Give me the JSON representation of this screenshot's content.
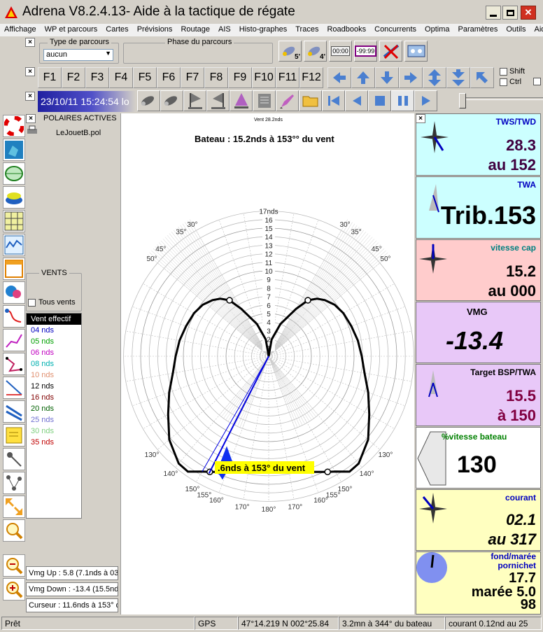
{
  "window": {
    "title": "Adrena V8.2.4.13- Aide à la tactique de régate"
  },
  "menu": [
    "Affichage",
    "WP et parcours",
    "Cartes",
    "Prévisions",
    "Routage",
    "AIS",
    "Histo-graphes",
    "Traces",
    "Roadbooks",
    "Concurrents",
    "Optima",
    "Paramètres",
    "Outils",
    "Aide"
  ],
  "toolbar1": {
    "type_parcours_label": "Type de parcours",
    "type_parcours_value": "aucun",
    "phase_label": "Phase du parcours",
    "btn_5": "5'",
    "btn_4": "4'",
    "btn_timer": "00:00",
    "btn_count": "-99:99"
  },
  "fkeys": [
    "F1",
    "F2",
    "F3",
    "F4",
    "F5",
    "F6",
    "F7",
    "F8",
    "F9",
    "F10",
    "F11",
    "F12"
  ],
  "mods": {
    "shift": "Shift",
    "ctrl": "Ctrl"
  },
  "datetime": "23/10/11 15:24:54 lo",
  "polaires": {
    "title": "POLAIRES ACTIVES",
    "file": "LeJouetB.pol"
  },
  "vents": {
    "title": "VENTS",
    "all_label": "Tous vents",
    "items": [
      {
        "label": "Vent effectif",
        "color": "#ffffff"
      },
      {
        "label": "04 nds",
        "color": "#0000c0"
      },
      {
        "label": "05 nds",
        "color": "#00a000"
      },
      {
        "label": "06 nds",
        "color": "#c000c0"
      },
      {
        "label": "08 nds",
        "color": "#00b0b0"
      },
      {
        "label": "10 nds",
        "color": "#e09070"
      },
      {
        "label": "12 nds",
        "color": "#000000"
      },
      {
        "label": "16 nds",
        "color": "#800000"
      },
      {
        "label": "20 nds",
        "color": "#006000"
      },
      {
        "label": "25 nds",
        "color": "#7070d0"
      },
      {
        "label": "30 nds",
        "color": "#80d080"
      },
      {
        "label": "35 nds",
        "color": "#c00000"
      }
    ]
  },
  "vmg": {
    "up": "Vmg Up : 5.8 (7.1nds à 035",
    "down": "Vmg Down : -13.4 (15.5nds",
    "cursor": "Curseur : 11.6nds à 153° d"
  },
  "polar": {
    "header": "Bateau : 15.2nds à 153°° du vent",
    "wind_label": "Vent 28.2nds",
    "ring_labels": [
      "1",
      "2",
      "3",
      "4",
      "5",
      "6",
      "7",
      "8",
      "9",
      "10",
      "11",
      "12",
      "13",
      "14",
      "15",
      "16",
      "17nds"
    ],
    "angle_labels": [
      {
        "a": -50,
        "t": "50°"
      },
      {
        "a": -45,
        "t": "45°"
      },
      {
        "a": -35,
        "t": "35°"
      },
      {
        "a": -30,
        "t": "30°"
      },
      {
        "a": 30,
        "t": "30°"
      },
      {
        "a": 35,
        "t": "35°"
      },
      {
        "a": 45,
        "t": "45°"
      },
      {
        "a": 50,
        "t": "50°"
      },
      {
        "a": -130,
        "t": "130°"
      },
      {
        "a": -140,
        "t": "140°"
      },
      {
        "a": -150,
        "t": "150°"
      },
      {
        "a": -155,
        "t": "155°"
      },
      {
        "a": -160,
        "t": "160°"
      },
      {
        "a": -170,
        "t": "170°"
      },
      {
        "a": 180,
        "t": "180°"
      },
      {
        "a": 170,
        "t": "170°"
      },
      {
        "a": 160,
        "t": "160°"
      },
      {
        "a": 155,
        "t": "155°"
      },
      {
        "a": 150,
        "t": "150°"
      },
      {
        "a": 140,
        "t": "140°"
      },
      {
        "a": 130,
        "t": "130°"
      }
    ],
    "cursor_label": ".6nds à 153° du vent"
  },
  "panels": {
    "tws": {
      "title": "TWS/TWD",
      "v1": "28.3",
      "v2": "au 152",
      "bg": "#ccffff",
      "color": "#400040"
    },
    "twa": {
      "title": "TWA",
      "v1": "Trib.153",
      "bg": "#ccffff"
    },
    "vcap": {
      "title": "vitesse cap",
      "v1": "15.2",
      "v2": "au 000",
      "bg": "#ffcccc"
    },
    "vmg": {
      "title": "VMG",
      "v1": "-13.4",
      "bg": "#e8c8f8"
    },
    "target": {
      "title": "Target BSP/TWA",
      "v1": "15.5",
      "v2": "à 150",
      "bg": "#e8c8f8",
      "color": "#800040"
    },
    "pct": {
      "title": "%vitesse bateau",
      "v1": "130",
      "bg": "#ffffff"
    },
    "courant": {
      "title": "courant",
      "v1": "02.1",
      "v2": "au 317",
      "bg": "#ffffc0"
    },
    "maree": {
      "title1": "fond/marée",
      "title2": "pornichet",
      "v1": "17.7",
      "v2": "marée 5.0",
      "v3": "98",
      "bg": "#ffffc0"
    }
  },
  "status": {
    "ready": "Prêt",
    "gps": "GPS",
    "position": "47°14.219 N  002°25.84",
    "bearing": "3.2mn à 344° du bateau",
    "current": "courant 0.12nd au 25"
  }
}
